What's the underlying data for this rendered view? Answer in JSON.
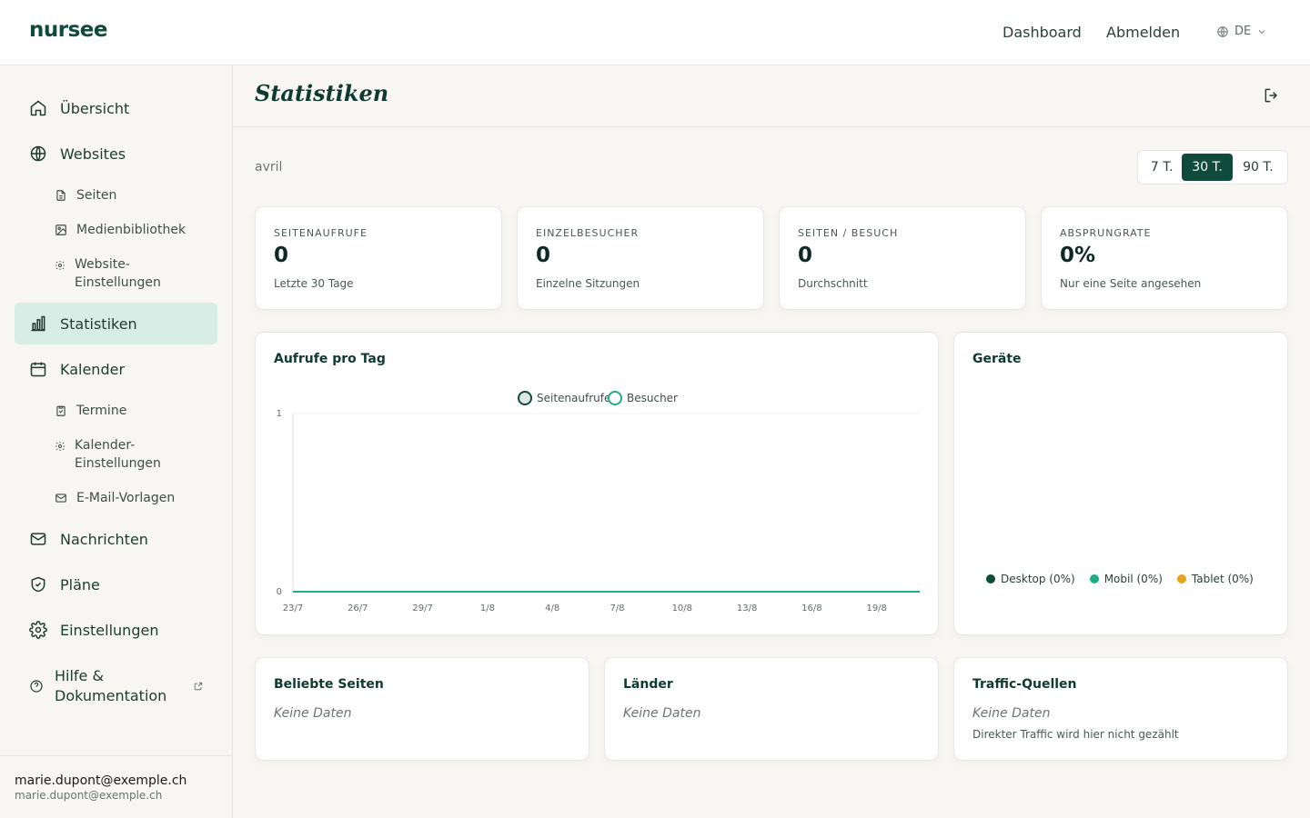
{
  "app": {
    "logo": "nursee"
  },
  "topnav": {
    "dashboard": "Dashboard",
    "logout": "Abmelden",
    "lang": "DE"
  },
  "sidebar": {
    "overview": "Übersicht",
    "websites": "Websites",
    "pages": "Seiten",
    "media": "Medienbibliothek",
    "website_settings": "Website-Einstellungen",
    "stats": "Statistiken",
    "calendar": "Kalender",
    "appointments": "Termine",
    "calendar_settings": "Kalender-Einstellungen",
    "email_templates": "E-Mail-Vorlagen",
    "messages": "Nachrichten",
    "plans": "Pläne",
    "settings": "Einstellungen",
    "help": "Hilfe & Dokumentation"
  },
  "user": {
    "name": "marie.dupont@exemple.ch",
    "email": "marie.dupont@exemple.ch"
  },
  "page": {
    "title": "Statistiken",
    "period_label": "avril"
  },
  "range": {
    "options": [
      "7 T.",
      "30 T.",
      "90 T."
    ],
    "selected": "30 T."
  },
  "stats": [
    {
      "label": "SEITENAUFRUFE",
      "value": "0",
      "sub": "Letzte 30 Tage"
    },
    {
      "label": "EINZELBESUCHER",
      "value": "0",
      "sub": "Einzelne Sitzungen"
    },
    {
      "label": "SEITEN / BESUCH",
      "value": "0",
      "sub": "Durchschnitt"
    },
    {
      "label": "ABSPRUNGRATE",
      "value": "0%",
      "sub": "Nur eine Seite angesehen"
    }
  ],
  "chart": {
    "title": "Aufrufe pro Tag"
  },
  "devices": {
    "title": "Geräte",
    "items": [
      {
        "label": "Desktop (0%)",
        "color": "#0f4a3b"
      },
      {
        "label": "Mobil (0%)",
        "color": "#1fae85"
      },
      {
        "label": "Tablet (0%)",
        "color": "#e9a21c"
      }
    ]
  },
  "panels": {
    "popular": {
      "title": "Beliebte Seiten",
      "empty": "Keine Daten"
    },
    "countries": {
      "title": "Länder",
      "empty": "Keine Daten"
    },
    "traffic": {
      "title": "Traffic-Quellen",
      "empty": "Keine Daten",
      "note": "Direkter Traffic wird hier nicht gezählt"
    }
  },
  "colors": {
    "brand": "#0f4a3b",
    "accent_bg": "#d6eee6",
    "visitors": "#1fae85"
  },
  "chart_data": {
    "type": "line",
    "title": "Aufrufe pro Tag",
    "x_ticks": [
      "23/7",
      "26/7",
      "29/7",
      "1/8",
      "4/8",
      "7/8",
      "10/8",
      "13/8",
      "16/8",
      "19/8"
    ],
    "y_ticks": [
      "0",
      "1"
    ],
    "ylim": [
      0,
      1
    ],
    "series": [
      {
        "name": "Seitenaufrufe",
        "values": [
          0,
          0,
          0,
          0,
          0,
          0,
          0,
          0,
          0,
          0
        ]
      },
      {
        "name": "Besucher",
        "values": [
          0,
          0,
          0,
          0,
          0,
          0,
          0,
          0,
          0,
          0
        ]
      }
    ],
    "legend": "top-center",
    "grid": false
  }
}
